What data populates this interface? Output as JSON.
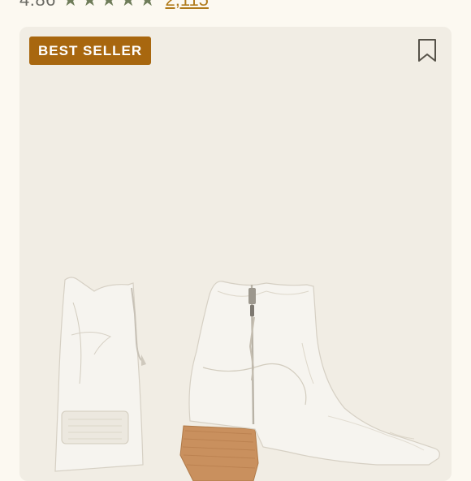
{
  "product": {
    "rating": "4.86",
    "stars_filled": 5,
    "stars_total": 5,
    "review_count": "2,115"
  },
  "image_card": {
    "badge_label": "BEST SELLER",
    "save_icon": "bookmark-icon",
    "image_subject": "white-western-ankle-boots"
  },
  "colors": {
    "badge": "#a8670f",
    "star": "#6f7d5a",
    "link": "#b07a1a",
    "card_bg": "#f1ede4",
    "page_bg": "#fcf9f1"
  }
}
